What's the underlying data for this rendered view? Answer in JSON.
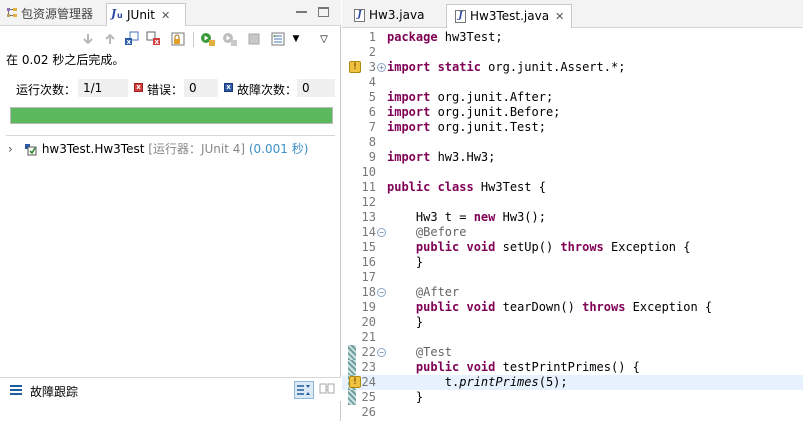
{
  "left_tabs": {
    "package_explorer": "包资源管理器",
    "junit": "JUnit",
    "close_glyph": "✕"
  },
  "junit": {
    "status": "在 0.02 秒之后完成。",
    "runs_label": "运行次数：",
    "runs_value": "1/1",
    "errors_label": "错误：",
    "errors_value": "0",
    "failures_label": "故障次数：",
    "failures_value": "0",
    "progress_percent": 100,
    "progress_color": "#5cb85c",
    "tree": {
      "name": "hw3Test.Hw3Test",
      "runner": "[运行器：JUnit 4]",
      "time": "(0.001 秒)"
    },
    "failure_trace_label": "故障跟踪"
  },
  "editor_tabs": [
    {
      "label": "Hw3.java",
      "active": false
    },
    {
      "label": "Hw3Test.java",
      "active": true
    }
  ],
  "code_lines": [
    {
      "n": "1",
      "html": "<span class=\"kw\">package</span> hw3Test;"
    },
    {
      "n": "2",
      "html": ""
    },
    {
      "n": "3",
      "html": "<span class=\"kw\">import static</span> org.junit.Assert.*;",
      "fold": "⊕",
      "warn": true
    },
    {
      "n": "4",
      "html": ""
    },
    {
      "n": "5",
      "html": "<span class=\"kw\">import</span> org.junit.After;"
    },
    {
      "n": "6",
      "html": "<span class=\"kw\">import</span> org.junit.Before;"
    },
    {
      "n": "7",
      "html": "<span class=\"kw\">import</span> org.junit.Test;"
    },
    {
      "n": "8",
      "html": ""
    },
    {
      "n": "9",
      "html": "<span class=\"kw\">import</span> hw3.Hw3;"
    },
    {
      "n": "10",
      "html": ""
    },
    {
      "n": "11",
      "html": "<span class=\"kw\">public class</span> Hw3Test {"
    },
    {
      "n": "12",
      "html": ""
    },
    {
      "n": "13",
      "html": "    Hw3 t = <span class=\"kw\">new</span> Hw3();"
    },
    {
      "n": "14",
      "html": "    <span class=\"ann\">@Before</span>",
      "fold": "⊖"
    },
    {
      "n": "15",
      "html": "    <span class=\"kw\">public void</span> setUp() <span class=\"kw\">throws</span> Exception {"
    },
    {
      "n": "16",
      "html": "    }"
    },
    {
      "n": "17",
      "html": ""
    },
    {
      "n": "18",
      "html": "    <span class=\"ann\">@After</span>",
      "fold": "⊖"
    },
    {
      "n": "19",
      "html": "    <span class=\"kw\">public void</span> tearDown() <span class=\"kw\">throws</span> Exception {"
    },
    {
      "n": "20",
      "html": "    }"
    },
    {
      "n": "21",
      "html": ""
    },
    {
      "n": "22",
      "html": "    <span class=\"ann\">@Test</span>",
      "fold": "⊖",
      "cov": true
    },
    {
      "n": "23",
      "html": "    <span class=\"kw\">public void</span> testPrintPrimes() {",
      "cov": true
    },
    {
      "n": "24",
      "html": "        t.<span class=\"ital\">printPrimes</span>(5);",
      "cov": true,
      "warn": true,
      "current": true
    },
    {
      "n": "25",
      "html": "    }",
      "cov": true
    },
    {
      "n": "26",
      "html": ""
    }
  ]
}
